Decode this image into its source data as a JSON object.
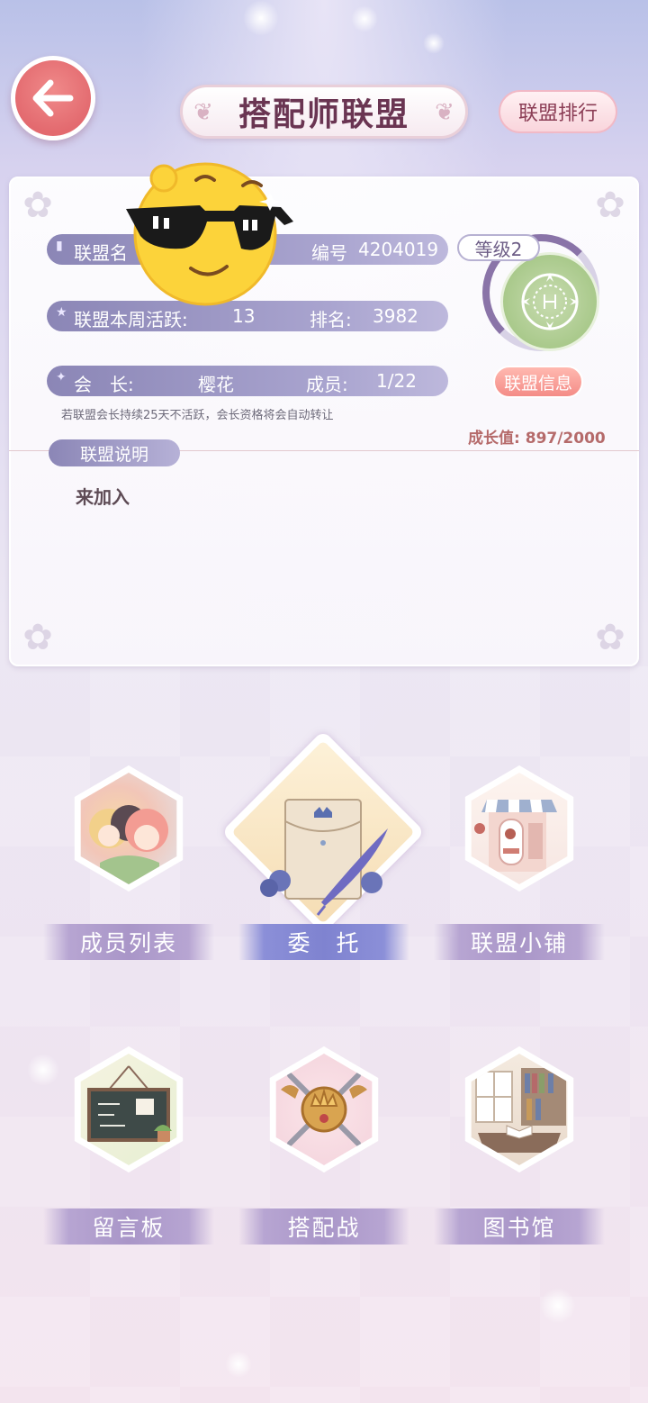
{
  "header": {
    "back_icon": "arrow-left-icon",
    "title": "搭配师联盟",
    "rank_button": "联盟排行"
  },
  "alliance": {
    "name_label": "联盟名",
    "id_label": "编号",
    "id_value": "4204019",
    "activity_label": "联盟本周活跃:",
    "activity_value": "13",
    "rank_label": "排名:",
    "rank_value": "3982",
    "leader_label": "会　长:",
    "leader_value": "樱花",
    "members_label": "成员:",
    "members_value": "1/22",
    "leader_note": "若联盟会长持续25天不活跃，会长资格将会自动转让",
    "level_label": "等级2",
    "info_button": "联盟信息",
    "growth_label": "成长值:",
    "growth_value": "897/2000",
    "growth_progress": 0.4485,
    "desc_label": "联盟说明",
    "desc_text": "来加入"
  },
  "menu": [
    {
      "label": "成员列表",
      "icon": "members-icon",
      "active": false
    },
    {
      "label": "委　托",
      "icon": "commission-icon",
      "active": true
    },
    {
      "label": "联盟小铺",
      "icon": "shop-icon",
      "active": false
    },
    {
      "label": "留言板",
      "icon": "message-board-icon",
      "active": false
    },
    {
      "label": "搭配战",
      "icon": "styling-battle-icon",
      "active": false
    },
    {
      "label": "图书馆",
      "icon": "library-icon",
      "active": false
    }
  ],
  "colors": {
    "accent": "#8b86b6",
    "back_button": "#e36a6f",
    "growth_text": "#b56a6a"
  }
}
